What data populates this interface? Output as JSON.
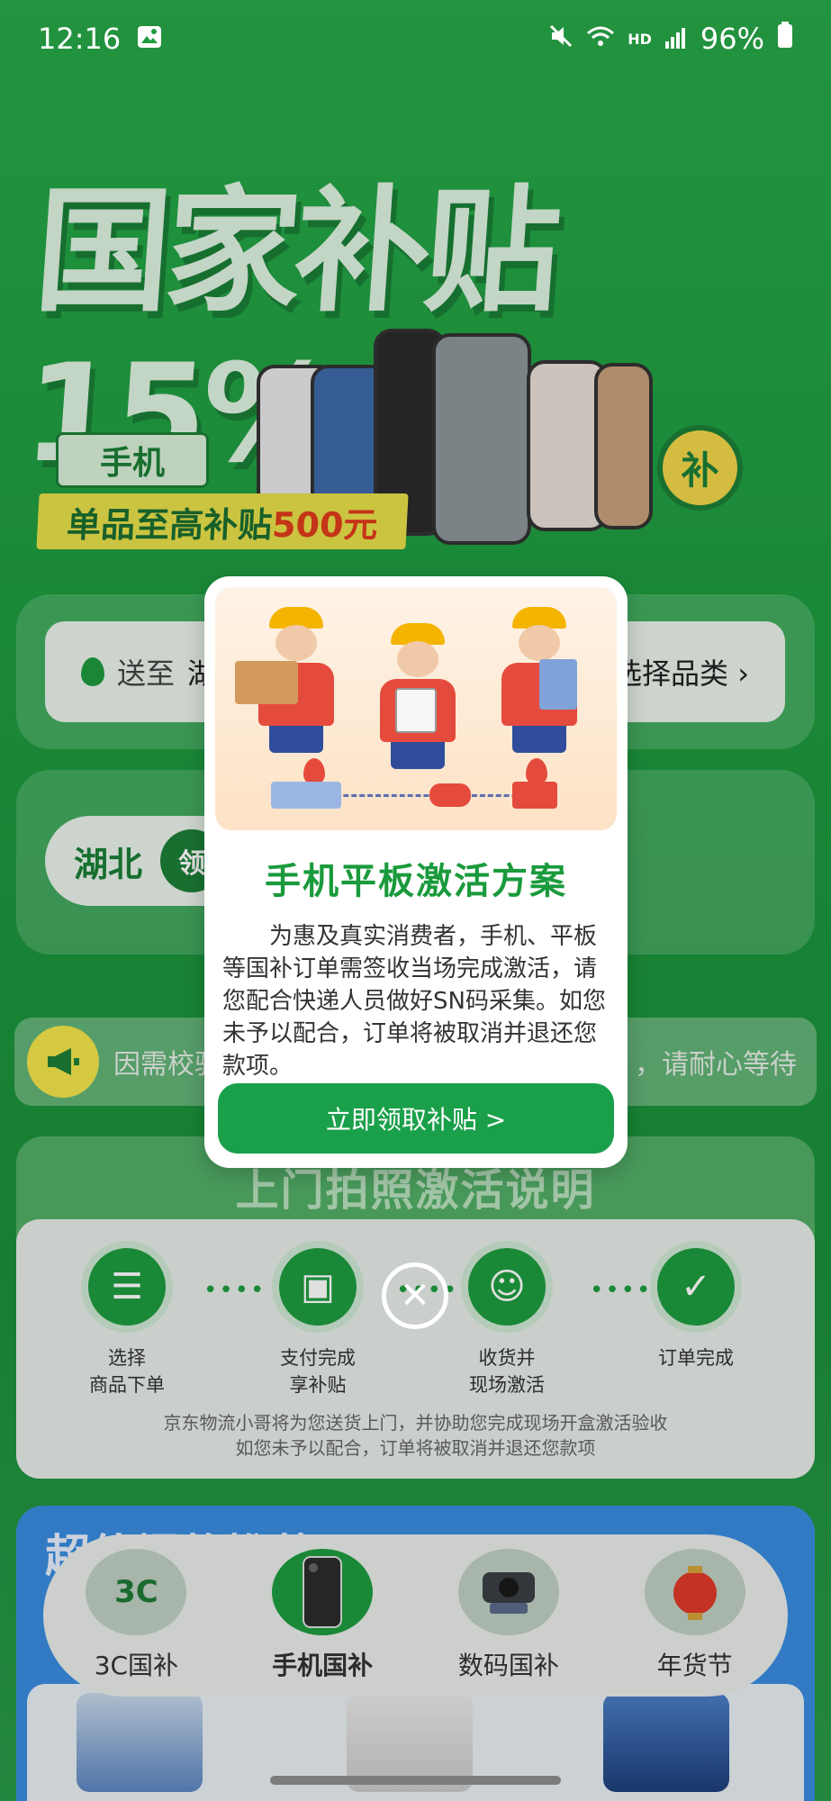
{
  "status_bar": {
    "time": "12:16",
    "network": "HD",
    "battery": "96%",
    "icons": [
      "image-icon",
      "mute-icon",
      "wifi-icon",
      "signal-icon",
      "battery-icon"
    ]
  },
  "hero": {
    "title": "国家补贴15%",
    "tag": "手机",
    "subsidy_prefix": "单品至高补贴",
    "subsidy_amount": "500元",
    "bu_badge": "补"
  },
  "location_bar": {
    "prefix": "送至",
    "region_partial": "湖",
    "category_button": "选择品类 ›"
  },
  "region_selector": {
    "label": "湖北",
    "action_partial": "领"
  },
  "notice": {
    "left_text": "因需校验",
    "right_text": "，请耐心等待"
  },
  "activation_section": {
    "title": "上门拍照激活说明",
    "steps": [
      {
        "label_line1": "选择",
        "label_line2": "商品下单",
        "icon": "order-icon"
      },
      {
        "label_line1": "支付完成",
        "label_line2": "享补贴",
        "icon": "wallet-icon"
      },
      {
        "label_line1": "收货并",
        "label_line2": "现场激活",
        "icon": "courier-icon"
      },
      {
        "label_line1": "订单完成",
        "label_line2": "",
        "icon": "check-icon"
      }
    ],
    "footer_line1": "京东物流小哥将为您送货上门，并协助您完成现场开盒激活验收",
    "footer_line2": "如您未予以配合，订单将被取消并退还您款项"
  },
  "promo": {
    "title_partial": "超值爆款推荐"
  },
  "bottom_nav": {
    "items": [
      {
        "label": "3C国补",
        "badge": "3C",
        "active": false
      },
      {
        "label": "手机国补",
        "badge": "",
        "active": true
      },
      {
        "label": "数码国补",
        "badge": "",
        "active": false
      },
      {
        "label": "年货节",
        "badge": "",
        "active": false
      }
    ]
  },
  "modal": {
    "title": "手机平板激活方案",
    "body": "为惠及真实消费者，手机、平板等国补订单需签收当场完成激活，请您配合快递人员做好SN码采集。如您未予以配合，订单将被取消并退还您款项。",
    "button_label": "立即领取补贴 >",
    "close_symbol": "✕"
  },
  "colors": {
    "brand_green": "#1aa04a",
    "title_green": "#1a9a3c",
    "background_green": "#1f9a3e"
  }
}
